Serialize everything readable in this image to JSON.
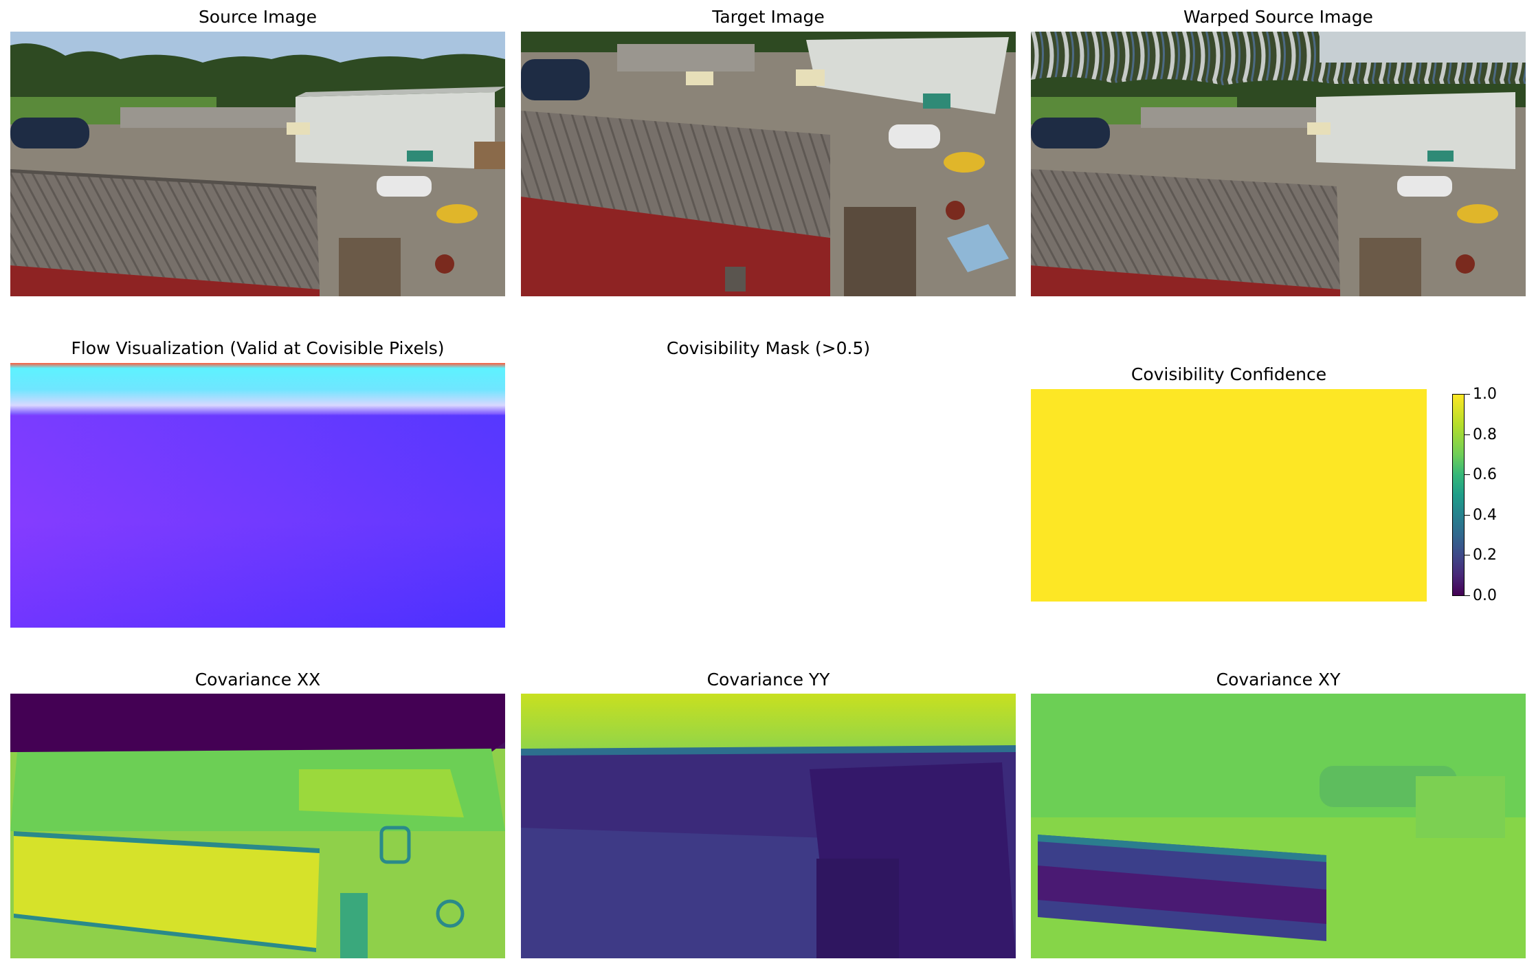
{
  "panels": {
    "source": "Source Image",
    "target": "Target Image",
    "warped": "Warped Source Image",
    "flow": "Flow Visualization (Valid at Covisible Pixels)",
    "mask": "Covisibility Mask (>0.5)",
    "confidence": "Covisibility Confidence",
    "covxx": "Covariance XX",
    "covyy": "Covariance YY",
    "covxy": "Covariance XY"
  },
  "colorbar": {
    "colormap": "viridis",
    "ticks": [
      "0.0",
      "0.2",
      "0.4",
      "0.6",
      "0.8",
      "1.0"
    ]
  },
  "colors": {
    "roof": "#77706a",
    "wall_red": "#8e2323",
    "building_white": "#d8dbd6",
    "sky": "#a9c4df",
    "trees": "#2e4a22",
    "gravel": "#8b8478",
    "flow_violet": "#7a3cff",
    "viridis_yellow": "#fde725"
  }
}
